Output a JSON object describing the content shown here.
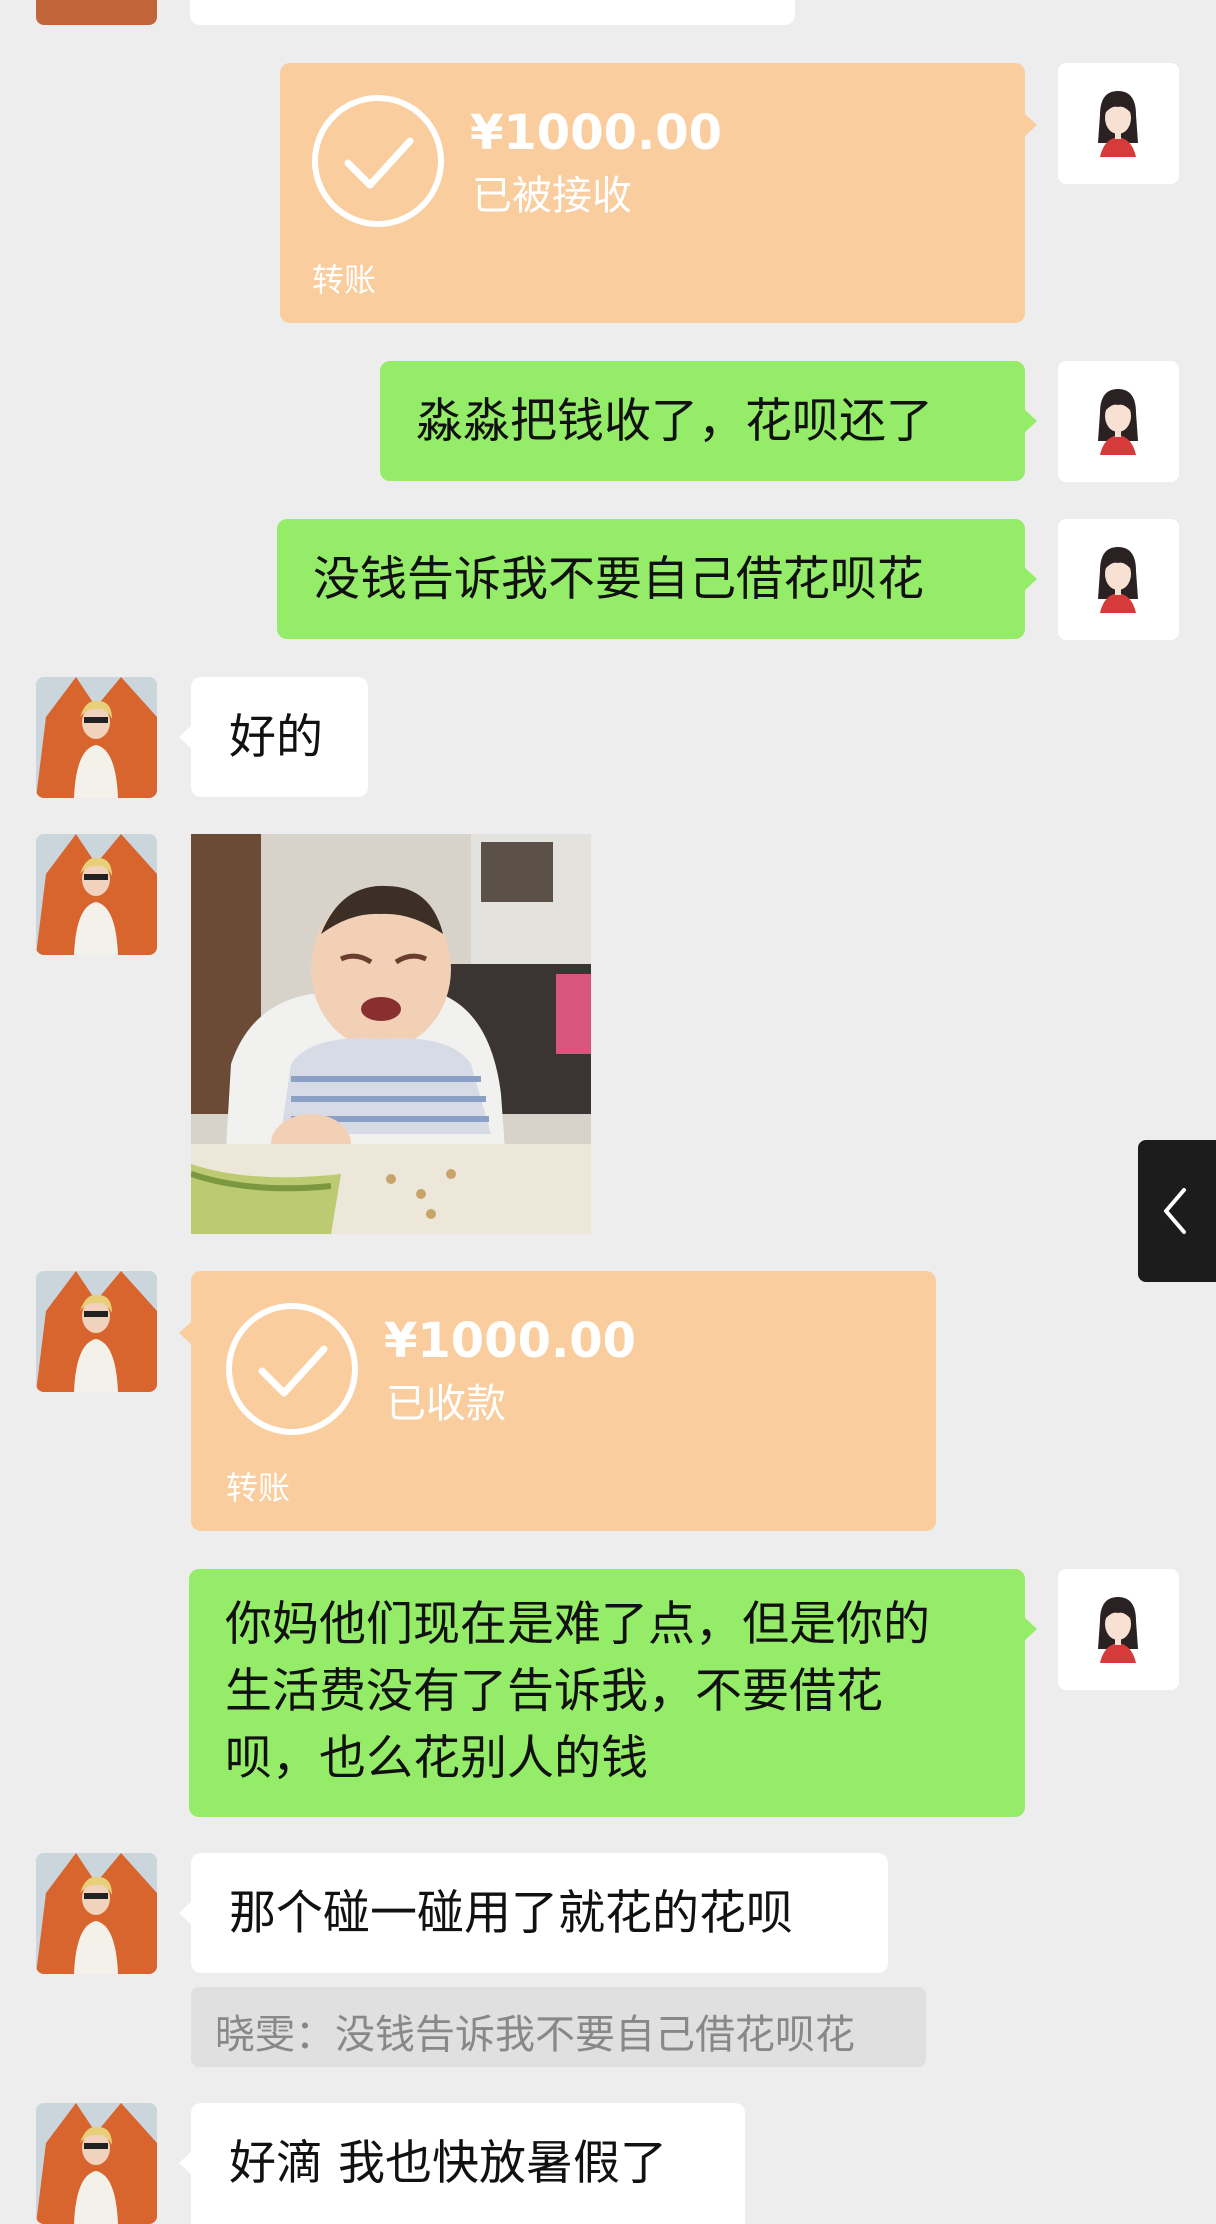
{
  "messages": {
    "transfer_sent": {
      "amount": "¥1000.00",
      "status": "已被接收",
      "label": "转账"
    },
    "m1": "淼淼把钱收了，花呗还了",
    "m2": "没钱告诉我不要自己借花呗花",
    "m3": "好的",
    "transfer_received": {
      "amount": "¥1000.00",
      "status": "已收款",
      "label": "转账"
    },
    "m4": {
      "line1": "你妈他们现在是难了点，但是你的",
      "line2": "生活费没有了告诉我，不要借花",
      "line3": "呗，也么花别人的钱"
    },
    "m5": "那个碰一碰用了就花的花呗",
    "quote": "晓雯：没钱告诉我不要自己借花呗花",
    "m6": "好滴 我也快放暑假了"
  },
  "colors": {
    "background": "#ededed",
    "bubble_self": "#95ec69",
    "bubble_other": "#ffffff",
    "transfer": "#f9cd9d"
  },
  "icons": {
    "check": "check-circle-icon",
    "side_tab": "chevron-left-icon"
  }
}
